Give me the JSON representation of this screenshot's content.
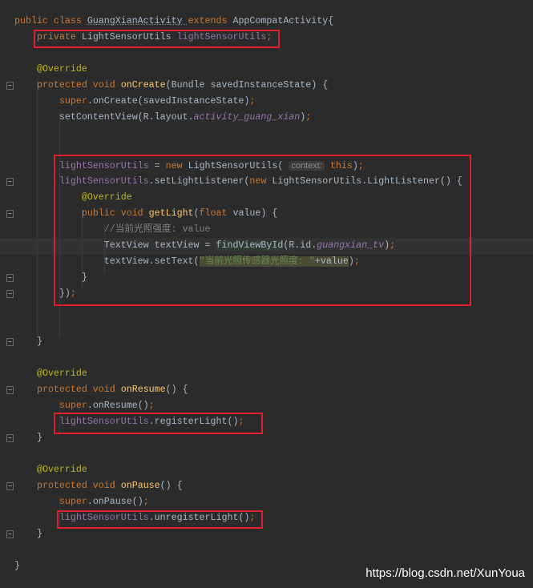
{
  "colors": {
    "background": "#2b2b2b",
    "k": "#cc7832",
    "p": "#a9b7c6",
    "f": "#9876aa",
    "m": "#ffc66d",
    "a": "#bbb529",
    "c": "#808080",
    "s": "#6a8759",
    "i": "#9876aa",
    "h": "#8c8c8c",
    "highlight_box": "#e0202a"
  },
  "code_lines": [
    [
      [
        "k",
        "public class "
      ],
      [
        "p",
        "GuangXianActivity "
      ],
      [
        "k",
        "extends "
      ],
      [
        "p",
        "AppCompatActivity{"
      ]
    ],
    [
      [
        "p",
        "    "
      ],
      [
        "k",
        "private "
      ],
      [
        "p",
        "LightSensorUtils "
      ],
      [
        "f",
        "lightSensorUtils"
      ],
      [
        "k",
        ";"
      ]
    ],
    [],
    [
      [
        "p",
        "    "
      ],
      [
        "a",
        "@Override"
      ]
    ],
    [
      [
        "p",
        "    "
      ],
      [
        "k",
        "protected void "
      ],
      [
        "m",
        "onCreate"
      ],
      [
        "p",
        "(Bundle savedInstanceState) {"
      ]
    ],
    [
      [
        "p",
        "        "
      ],
      [
        "k",
        "super"
      ],
      [
        "p",
        ".onCreate(savedInstanceState)"
      ],
      [
        "k",
        ";"
      ]
    ],
    [
      [
        "p",
        "        setContentView(R.layout."
      ],
      [
        "i",
        "activity_guang_xian"
      ],
      [
        "p",
        ")"
      ],
      [
        "k",
        ";"
      ]
    ],
    [],
    [],
    [
      [
        "p",
        "        "
      ],
      [
        "f",
        "lightSensorUtils"
      ],
      [
        "p",
        " = "
      ],
      [
        "k",
        "new "
      ],
      [
        "p",
        "LightSensorUtils( "
      ],
      [
        "h",
        "context:"
      ],
      [
        "k",
        " this"
      ],
      [
        "p",
        ")"
      ],
      [
        "k",
        ";"
      ]
    ],
    [
      [
        "p",
        "        "
      ],
      [
        "f",
        "lightSensorUtils"
      ],
      [
        "p",
        ".setLightListener("
      ],
      [
        "k",
        "new "
      ],
      [
        "p",
        "LightSensorUtils.LightListener() {"
      ]
    ],
    [
      [
        "p",
        "            "
      ],
      [
        "a",
        "@Override"
      ]
    ],
    [
      [
        "p",
        "            "
      ],
      [
        "k",
        "public void "
      ],
      [
        "m",
        "getLight"
      ],
      [
        "p",
        "("
      ],
      [
        "k",
        "float "
      ],
      [
        "p",
        "value) {"
      ]
    ],
    [
      [
        "p",
        "                "
      ],
      [
        "c",
        "//当前光照强度: value"
      ]
    ],
    [
      [
        "p",
        "                TextView textView = "
      ],
      [
        "m2",
        "findViewById"
      ],
      [
        "p",
        "(R.id."
      ],
      [
        "i",
        "guangxian_tv"
      ],
      [
        "p",
        ")"
      ],
      [
        "k",
        ";"
      ]
    ],
    [
      [
        "p",
        "                textView.setText("
      ],
      [
        "s2",
        "\"当前光照传感器光照度: \""
      ],
      [
        "p2",
        "+value"
      ],
      [
        "p",
        ")"
      ],
      [
        "k",
        ";"
      ]
    ],
    [
      [
        "p",
        "            }"
      ]
    ],
    [
      [
        "p",
        "        })"
      ],
      [
        "k",
        ";"
      ]
    ],
    [],
    [],
    [
      [
        "p",
        "    }"
      ]
    ],
    [],
    [
      [
        "p",
        "    "
      ],
      [
        "a",
        "@Override"
      ]
    ],
    [
      [
        "p",
        "    "
      ],
      [
        "k",
        "protected void "
      ],
      [
        "m",
        "onResume"
      ],
      [
        "p",
        "() {"
      ]
    ],
    [
      [
        "p",
        "        "
      ],
      [
        "k",
        "super"
      ],
      [
        "p",
        ".onResume()"
      ],
      [
        "k",
        ";"
      ]
    ],
    [
      [
        "p",
        "        "
      ],
      [
        "f",
        "lightSensorUtils"
      ],
      [
        "p",
        ".registerLight()"
      ],
      [
        "k",
        ";"
      ]
    ],
    [
      [
        "p",
        "    }"
      ]
    ],
    [],
    [
      [
        "p",
        "    "
      ],
      [
        "a",
        "@Override"
      ]
    ],
    [
      [
        "p",
        "    "
      ],
      [
        "k",
        "protected void "
      ],
      [
        "m",
        "onPause"
      ],
      [
        "p",
        "() {"
      ]
    ],
    [
      [
        "p",
        "        "
      ],
      [
        "k",
        "super"
      ],
      [
        "p",
        ".onPause()"
      ],
      [
        "k",
        ";"
      ]
    ],
    [
      [
        "p",
        "        "
      ],
      [
        "f",
        "lightSensorUtils"
      ],
      [
        "p",
        ".unregisterLight()"
      ],
      [
        "k",
        ";"
      ]
    ],
    [
      [
        "p",
        "    }"
      ]
    ],
    [],
    [
      [
        "p",
        "}"
      ]
    ]
  ],
  "current_line": 14,
  "watermark": "https://blog.csdn.net/XunYoua"
}
